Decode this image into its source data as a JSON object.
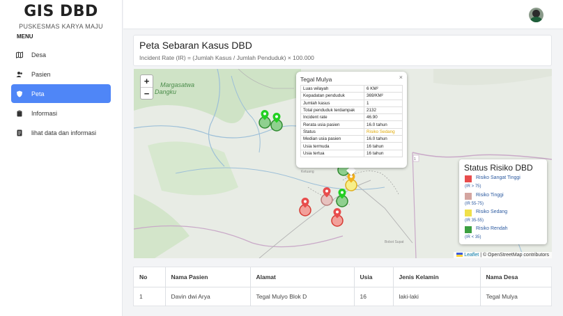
{
  "brand": {
    "title": "GIS DBD",
    "subtitle": "PUSKESMAS KARYA MAJU"
  },
  "sidebar": {
    "menu_title": "MENU",
    "items": [
      {
        "label": "Desa",
        "icon": "map-icon"
      },
      {
        "label": "Pasien",
        "icon": "users-icon"
      },
      {
        "label": "Peta",
        "icon": "shield-icon",
        "active": true
      },
      {
        "label": "Informasi",
        "icon": "clipboard-icon"
      },
      {
        "label": "lihat data dan informasi",
        "icon": "file-icon"
      }
    ]
  },
  "header": {
    "avatar": "user-avatar"
  },
  "page": {
    "title": "Peta Sebaran Kasus DBD",
    "formula": "Incident Rate (IR) = (Jumlah Kasus / Jumlah Penduduk) × 100.000"
  },
  "map": {
    "place_label_1": "Margasatwa",
    "place_label_2": "Dangku",
    "zoom_in": "+",
    "zoom_out": "−",
    "popup": {
      "title": "Tegal Mulya",
      "close": "×",
      "rows": [
        {
          "k": "Luas wilayah",
          "v": "6 KM²"
        },
        {
          "k": "Kepadatan penduduk",
          "v": "369/KM²"
        },
        {
          "k": "Jumlah kasus",
          "v": "1"
        },
        {
          "k": "Total penduduk terdampak",
          "v": "2132"
        },
        {
          "k": "Incident rate",
          "v": "46.90"
        },
        {
          "k": "Rerata usia pasien",
          "v": "16.0 tahun"
        },
        {
          "k": "Status",
          "v": "Risiko Sedang"
        },
        {
          "k": "Median usia pasien",
          "v": "16.0 tahun"
        },
        {
          "k": "Usia termuda",
          "v": "16 tahun"
        },
        {
          "k": "Usia tertua",
          "v": "16 tahun"
        }
      ]
    },
    "legend": {
      "title": "Status Risiko DBD",
      "items": [
        {
          "name": "Risiko Sangat Tinggi",
          "range": "(IR > 75)",
          "color": "#e84c4c"
        },
        {
          "name": "Risiko Tinggi",
          "range": "(IR 55-75)",
          "color": "#d4a5a0"
        },
        {
          "name": "Risiko Sedang",
          "range": "(IR 35-55)",
          "color": "#f0e04a"
        },
        {
          "name": "Risiko Rendah",
          "range": "(IR < 35)",
          "color": "#3ca040"
        }
      ]
    },
    "attribution_leaflet": "Leaflet",
    "attribution_rest": " | © OpenStreetMap contributors"
  },
  "table": {
    "headers": [
      "No",
      "Nama Pasien",
      "Alamat",
      "Usia",
      "Jenis Kelamin",
      "Nama Desa"
    ],
    "rows": [
      [
        "1",
        "Davin dwi Arya",
        "Tegal Mulyo Blok D",
        "16",
        "laki-laki",
        "Tegal Mulya"
      ]
    ]
  }
}
